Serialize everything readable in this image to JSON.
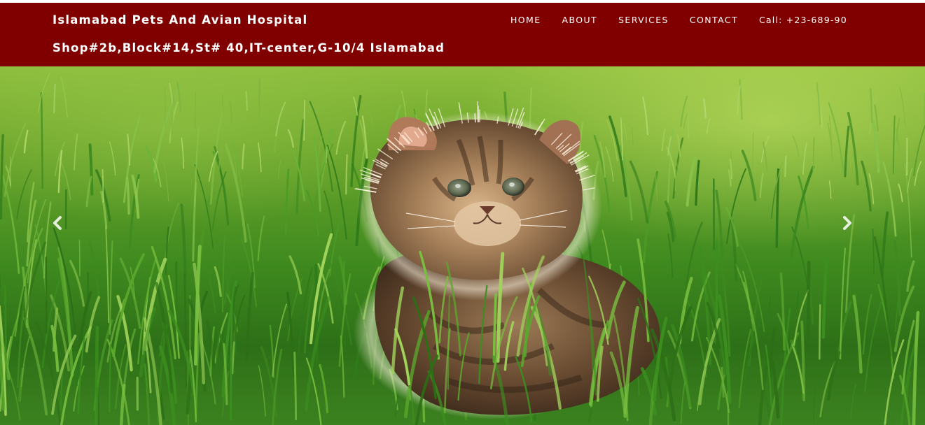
{
  "header": {
    "title": "Islamabad Pets And Avian Hospital",
    "address": "Shop#2b,Block#14,St# 40,IT-center,G-10/4 Islamabad",
    "background_color": "#800000"
  },
  "nav": {
    "items": [
      {
        "label": "HOME"
      },
      {
        "label": "ABOUT"
      },
      {
        "label": "SERVICES"
      },
      {
        "label": "CONTACT"
      },
      {
        "label": "Call: +23-689-90"
      }
    ]
  },
  "hero": {
    "image": "kitten-in-grass-photo",
    "controls": {
      "prev_icon": "chevron-left-icon",
      "next_icon": "chevron-right-icon"
    }
  }
}
